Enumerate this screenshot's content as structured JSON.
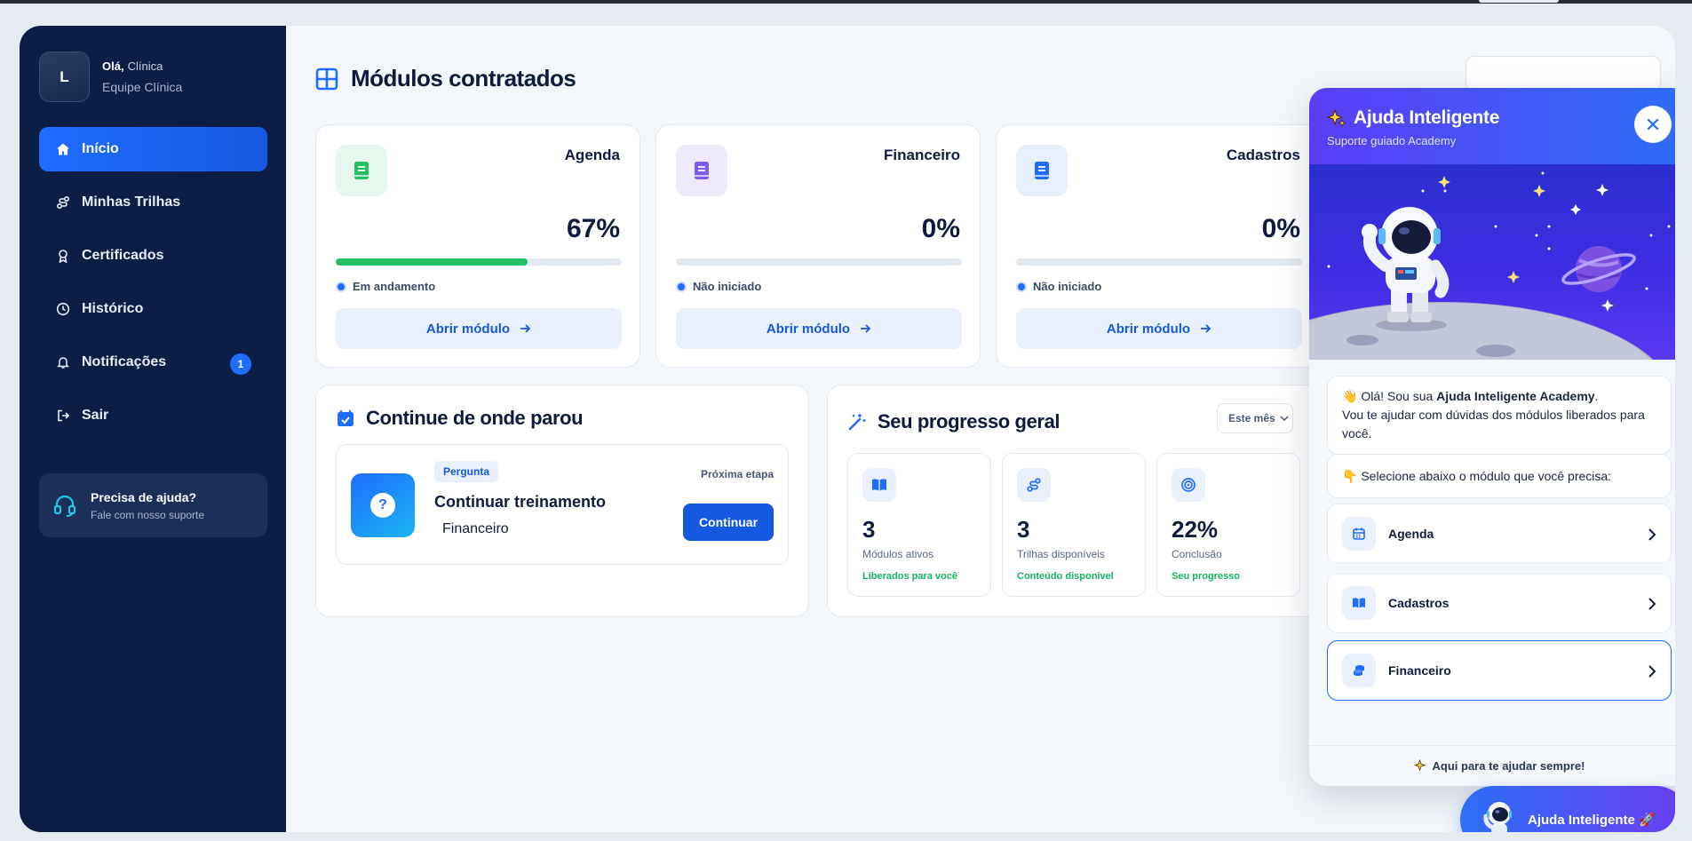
{
  "profile": {
    "initial": "L",
    "greeting": "Olá,",
    "name": "Clínica",
    "team": "Equipe Clínica"
  },
  "nav": [
    {
      "label": "Início",
      "icon": "home-icon",
      "active": true
    },
    {
      "label": "Minhas Trilhas",
      "icon": "route-icon"
    },
    {
      "label": "Certificados",
      "icon": "award-icon"
    },
    {
      "label": "Histórico",
      "icon": "clock-icon"
    },
    {
      "label": "Notificações",
      "icon": "bell-icon",
      "badge": "1"
    },
    {
      "label": "Sair",
      "icon": "logout-icon"
    }
  ],
  "help_box": {
    "title": "Precisa de ajuda?",
    "subtitle": "Fale com nosso suporte"
  },
  "modules_section": {
    "title": "Módulos contratados"
  },
  "modules": [
    {
      "name": "Agenda",
      "percent": "67%",
      "progress": 0.67,
      "status": "Em andamento",
      "button": "Abrir módulo",
      "accent": "#22c065",
      "icon_bg": "#e6f8ee"
    },
    {
      "name": "Financeiro",
      "percent": "0%",
      "progress": 0,
      "status": "Não iniciado",
      "button": "Abrir módulo",
      "accent": "#7b5cf0",
      "icon_bg": "#efeafd"
    },
    {
      "name": "Cadastros",
      "percent": "0%",
      "progress": 0,
      "status": "Não iniciado",
      "button": "Abrir módulo",
      "accent": "#1f6cff",
      "icon_bg": "#e8f0fe"
    }
  ],
  "continue": {
    "title": "Continue de onde parou",
    "tag": "Pergunta",
    "item_title": "Continuar treinamento",
    "item_module": "Financeiro",
    "next_label": "Próxima etapa",
    "button": "Continuar"
  },
  "progress": {
    "title": "Seu progresso geral",
    "period": "Este mês",
    "stats": [
      {
        "value": "3",
        "label": "Módulos ativos",
        "note": "Liberados para você",
        "icon": "book-icon"
      },
      {
        "value": "3",
        "label": "Trilhas disponíveis",
        "note": "Conteúdo disponível",
        "icon": "route-icon"
      },
      {
        "value": "22%",
        "label": "Conclusão",
        "note": "Seu progresso",
        "icon": "target-icon"
      }
    ]
  },
  "assistant": {
    "title": "Ajuda Inteligente",
    "subtitle": "Suporte guiado Academy",
    "intro_prefix": "Olá! Sou sua ",
    "intro_bold": "Ajuda Inteligente Academy",
    "intro_suffix": ".",
    "intro_line2": "Vou te ajudar com dúvidas dos módulos liberados para você.",
    "select_prompt": "Selecione abaixo o módulo que você precisa:",
    "options": [
      {
        "label": "Agenda",
        "icon": "calendar-icon"
      },
      {
        "label": "Cadastros",
        "icon": "book-open-icon"
      },
      {
        "label": "Financeiro",
        "icon": "coins-icon",
        "selected": true
      }
    ],
    "footer": "Aqui para te ajudar sempre!"
  },
  "fab": {
    "label": "Ajuda Inteligente 🚀"
  },
  "colors": {
    "sidebar": "#0c1e45",
    "primary": "#1f6cff",
    "success": "#22c065",
    "assistant_gradient_start": "#5b3df5"
  }
}
